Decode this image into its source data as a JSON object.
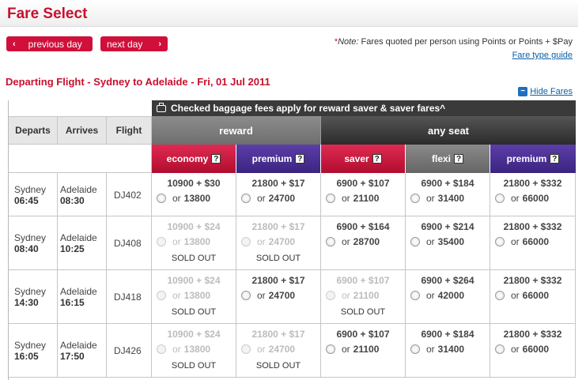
{
  "page": {
    "title": "Fare Select"
  },
  "nav": {
    "previous_label": "previous day",
    "next_label": "next day",
    "prev_chevron": "‹",
    "next_chevron": "›"
  },
  "note": {
    "asterisk": "*",
    "label": "Note:",
    "text": "Fares quoted per person using Points or Points + $Pay",
    "guide_link": "Fare type guide"
  },
  "flight": {
    "heading": "Departing Flight - Sydney to Adelaide - Fri, 01 Jul 2011",
    "hide_fares": "Hide Fares",
    "hide_icon": "−"
  },
  "table": {
    "baggage_notice": "Checked baggage fees apply for reward saver & saver fares^",
    "groups": {
      "reward": "reward",
      "any_seat": "any seat"
    },
    "columns": {
      "departs": "Departs",
      "arrives": "Arrives",
      "flight": "Flight"
    },
    "fare_types": [
      {
        "label": "economy",
        "help": "?"
      },
      {
        "label": "premium",
        "help": "?"
      },
      {
        "label": "saver",
        "help": "?"
      },
      {
        "label": "flexi",
        "help": "?"
      },
      {
        "label": "premium",
        "help": "?"
      }
    ],
    "or_label": "or",
    "sold_out_label": "SOLD OUT",
    "rows": [
      {
        "from": "Sydney",
        "dep": "06:45",
        "to": "Adelaide",
        "arr": "08:30",
        "flight": "DJ402",
        "fares": [
          {
            "price": "10900 + $30",
            "points": "13800",
            "sold_out": false
          },
          {
            "price": "21800 + $17",
            "points": "24700",
            "sold_out": false
          },
          {
            "price": "6900 + $107",
            "points": "21100",
            "sold_out": false
          },
          {
            "price": "6900 + $184",
            "points": "31400",
            "sold_out": false
          },
          {
            "price": "21800 + $332",
            "points": "66000",
            "sold_out": false
          }
        ]
      },
      {
        "from": "Sydney",
        "dep": "08:40",
        "to": "Adelaide",
        "arr": "10:25",
        "flight": "DJ408",
        "fares": [
          {
            "price": "10900 + $24",
            "points": "13800",
            "sold_out": true
          },
          {
            "price": "21800 + $17",
            "points": "24700",
            "sold_out": true
          },
          {
            "price": "6900 + $164",
            "points": "28700",
            "sold_out": false
          },
          {
            "price": "6900 + $214",
            "points": "35400",
            "sold_out": false
          },
          {
            "price": "21800 + $332",
            "points": "66000",
            "sold_out": false
          }
        ]
      },
      {
        "from": "Sydney",
        "dep": "14:30",
        "to": "Adelaide",
        "arr": "16:15",
        "flight": "DJ418",
        "fares": [
          {
            "price": "10900 + $24",
            "points": "13800",
            "sold_out": true
          },
          {
            "price": "21800 + $17",
            "points": "24700",
            "sold_out": false
          },
          {
            "price": "6900 + $107",
            "points": "21100",
            "sold_out": true
          },
          {
            "price": "6900 + $264",
            "points": "42000",
            "sold_out": false
          },
          {
            "price": "21800 + $332",
            "points": "66000",
            "sold_out": false
          }
        ]
      },
      {
        "from": "Sydney",
        "dep": "16:05",
        "to": "Adelaide",
        "arr": "17:50",
        "flight": "DJ426",
        "fares": [
          {
            "price": "10900 + $24",
            "points": "13800",
            "sold_out": true
          },
          {
            "price": "21800 + $17",
            "points": "24700",
            "sold_out": true
          },
          {
            "price": "6900 + $107",
            "points": "21100",
            "sold_out": false
          },
          {
            "price": "6900 + $184",
            "points": "31400",
            "sold_out": false
          },
          {
            "price": "21800 + $332",
            "points": "66000",
            "sold_out": false
          }
        ]
      }
    ]
  },
  "colors": {
    "brand": "#c8102e",
    "reward_group": "#7a7a7a",
    "any_seat_group": "#333333",
    "premium": "#4a2f94",
    "link": "#0b5fa5"
  }
}
